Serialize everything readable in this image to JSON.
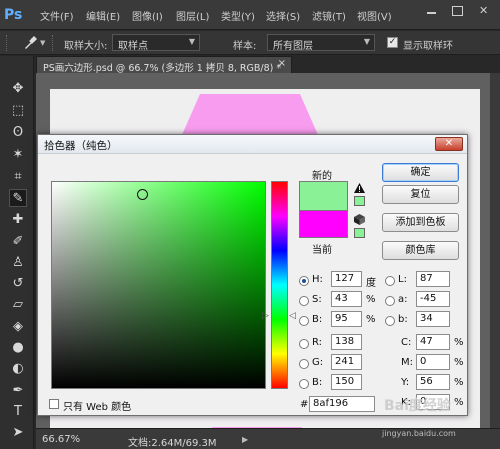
{
  "app": {
    "logo": "Ps"
  },
  "menubar": {
    "items": [
      {
        "label": "文件(F)"
      },
      {
        "label": "编辑(E)"
      },
      {
        "label": "图像(I)"
      },
      {
        "label": "图层(L)"
      },
      {
        "label": "类型(Y)"
      },
      {
        "label": "选择(S)"
      },
      {
        "label": "滤镜(T)"
      },
      {
        "label": "视图(V)"
      }
    ]
  },
  "optionsbar": {
    "tool_icon": "eyedropper-icon",
    "sample_size_label": "取样大小:",
    "sample_size_value": "取样点",
    "sample_label": "样本:",
    "sample_value": "所有图层",
    "show_ring_checked": true,
    "show_ring_label": "显示取样环"
  },
  "toolbox": {
    "tools": [
      {
        "name": "move-tool-icon",
        "glyph": "✥"
      },
      {
        "name": "marquee-tool-icon",
        "glyph": "⬚"
      },
      {
        "name": "lasso-tool-icon",
        "glyph": "ʘ"
      },
      {
        "name": "magic-wand-tool-icon",
        "glyph": "✶"
      },
      {
        "name": "crop-tool-icon",
        "glyph": "⌗"
      },
      {
        "name": "eyedropper-tool-icon",
        "glyph": "✎"
      },
      {
        "name": "healing-brush-tool-icon",
        "glyph": "✚"
      },
      {
        "name": "brush-tool-icon",
        "glyph": "✐"
      },
      {
        "name": "stamp-tool-icon",
        "glyph": "♙"
      },
      {
        "name": "history-brush-tool-icon",
        "glyph": "↺"
      },
      {
        "name": "eraser-tool-icon",
        "glyph": "▱"
      },
      {
        "name": "paint-bucket-tool-icon",
        "glyph": "◈"
      },
      {
        "name": "blur-tool-icon",
        "glyph": "●"
      },
      {
        "name": "dodge-tool-icon",
        "glyph": "◐"
      },
      {
        "name": "pen-tool-icon",
        "glyph": "✒"
      },
      {
        "name": "type-tool-icon",
        "glyph": "T"
      },
      {
        "name": "path-selection-tool-icon",
        "glyph": "➤"
      }
    ]
  },
  "document": {
    "tab_title": "PS画六边形.psd @ 66.7% (多边形 1 拷贝 8, RGB/8) *",
    "tab_close": "×",
    "shape_color": "#f79cee",
    "zoom": "66.67%",
    "doc_info": "文档:2.64M/69.3M"
  },
  "picker": {
    "title": "拾色器（纯色）",
    "close": "✕",
    "new_label": "新的",
    "current_label": "当前",
    "new_color": "#8af196",
    "current_color": "#ff00ff",
    "buttons": {
      "ok": "确定",
      "reset": "复位",
      "add_to_swatches": "添加到色板",
      "color_libraries": "颜色库"
    },
    "fields": {
      "h": {
        "label": "H:",
        "value": "127",
        "unit": "度",
        "selected": true
      },
      "s": {
        "label": "S:",
        "value": "43",
        "unit": "%"
      },
      "b": {
        "label": "B:",
        "value": "95",
        "unit": "%"
      },
      "r": {
        "label": "R:",
        "value": "138"
      },
      "g": {
        "label": "G:",
        "value": "241"
      },
      "b2": {
        "label": "B:",
        "value": "150"
      },
      "l": {
        "label": "L:",
        "value": "87"
      },
      "a": {
        "label": "a:",
        "value": "-45"
      },
      "lab_b": {
        "label": "b:",
        "value": "34"
      },
      "c": {
        "label": "C:",
        "value": "47",
        "unit": "%"
      },
      "m": {
        "label": "M:",
        "value": "0",
        "unit": "%"
      },
      "y": {
        "label": "Y:",
        "value": "56",
        "unit": "%"
      },
      "k": {
        "label": "K:",
        "value": "0",
        "unit": "%"
      }
    },
    "web_only_label": "只有 Web 颜色",
    "hex_hash": "#",
    "hex_value": "8af196"
  },
  "watermark": {
    "line1": "Bai度经验",
    "line2": "jingyan.baidu.com"
  }
}
